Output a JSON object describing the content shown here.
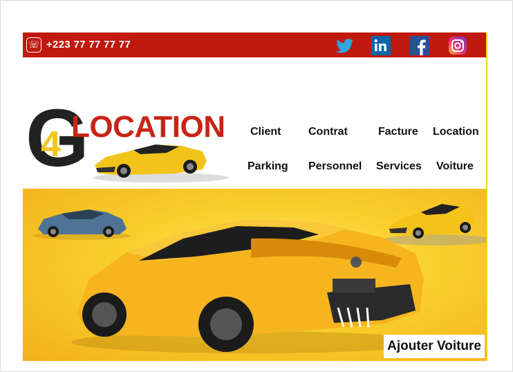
{
  "topbar": {
    "phone": "+223 77 77 77 77",
    "phone_icon": "phone-ring-icon",
    "social": [
      "twitter-icon",
      "linkedin-icon",
      "facebook-icon",
      "instagram-icon"
    ],
    "color": "#c0190f"
  },
  "logo": {
    "letter_g": "G",
    "digit": "4",
    "word": "LOCATION"
  },
  "nav": {
    "row1": [
      "Client",
      "Contrat",
      "Facture",
      "Location"
    ],
    "row2": [
      "Parking",
      "Personnel",
      "Services",
      "Voiture"
    ]
  },
  "banner": {
    "button_label": "Ajouter Voiture",
    "background": "#f9cf2c"
  }
}
